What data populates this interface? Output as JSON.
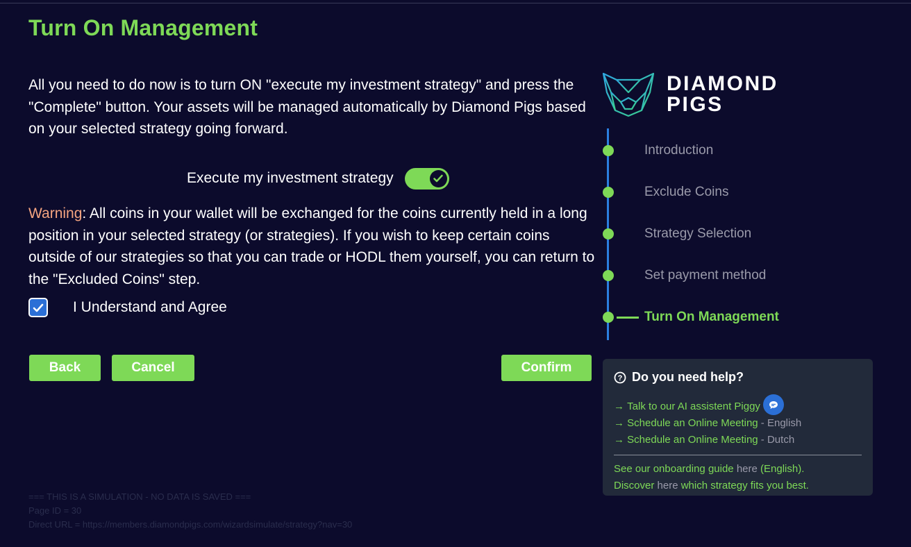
{
  "title": "Turn On Management",
  "intro": "All you need to do now is to turn ON \"execute my investment strategy\" and press the \"Complete\" button. Your assets will be managed automatically by Diamond Pigs based on your selected strategy going forward.",
  "toggle": {
    "label": "Execute my investment strategy",
    "on": true
  },
  "warning": {
    "label": "Warning",
    "text": ": All coins in your wallet will be exchanged for the coins currently held in a long position in your selected strategy (or strategies). If you wish to keep certain coins outside of our strategies so that you can trade or HODL them yourself, you can return to the \"Excluded Coins\" step."
  },
  "agree": {
    "label": "I Understand and Agree",
    "checked": true
  },
  "buttons": {
    "back": "Back",
    "cancel": "Cancel",
    "confirm": "Confirm"
  },
  "logo": {
    "line1": "DIAMOND",
    "line2": "PIGS"
  },
  "steps": [
    {
      "label": "Introduction"
    },
    {
      "label": "Exclude Coins"
    },
    {
      "label": "Strategy Selection"
    },
    {
      "label": "Set payment method"
    },
    {
      "label": "Turn On Management",
      "active": true
    }
  ],
  "help": {
    "title": "Do you need help?",
    "links": [
      {
        "arrow": "→",
        "text": "Talk to our AI assistent Piggy",
        "suffix": ""
      },
      {
        "arrow": "→",
        "text": "Schedule an Online Meeting",
        "suffix": " - English"
      },
      {
        "arrow": "→",
        "text": "Schedule an Online Meeting",
        "suffix": " - Dutch"
      }
    ],
    "guide": {
      "pre": "See our onboarding guide ",
      "link": "here",
      "post": " (English)."
    },
    "discover": {
      "pre": "Discover ",
      "link": "here",
      "post": " which strategy fits you best."
    }
  },
  "simulation": {
    "line1": "=== THIS IS A SIMULATION - NO DATA IS SAVED ===",
    "line2": "Page ID = 30",
    "line3": "Direct URL = https://members.diamondpigs.com/wizardsimulate/strategy?nav=30"
  },
  "colors": {
    "accent": "#7ed957",
    "background": "#0c0b2c",
    "blue": "#2b6fd6",
    "warning": "#f4a480"
  }
}
